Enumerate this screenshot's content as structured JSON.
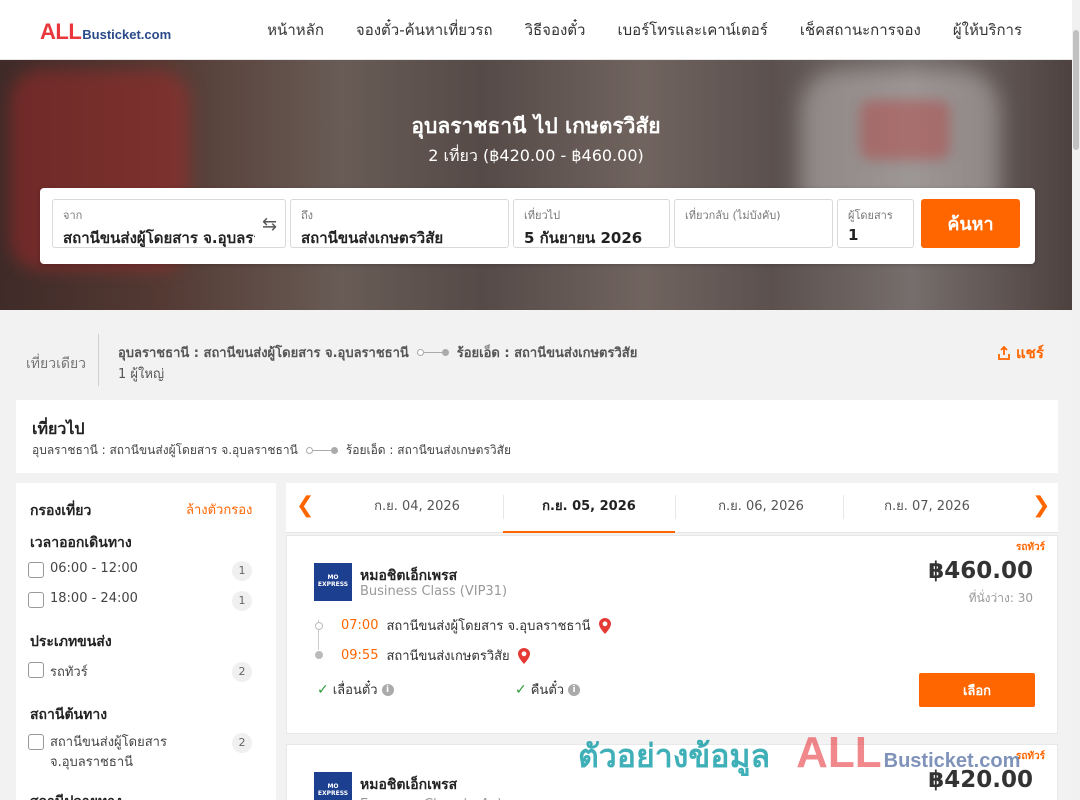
{
  "header": {
    "logo_main": "ALL",
    "logo_sub": "Busticket.com",
    "nav": [
      "หน้าหลัก",
      "จองตั๋ว-ค้นหาเที่ยวรถ",
      "วิธีจองตั๋ว",
      "เบอร์โทรและเคาน์เตอร์",
      "เช็คสถานะการจอง",
      "ผู้ให้บริการ"
    ]
  },
  "hero": {
    "title": "อุบลราชธานี ไป เกษตรวิสัย",
    "subtitle": "2 เที่ยว (฿420.00 - ฿460.00)"
  },
  "search": {
    "from_label": "จาก",
    "from_value": "สถานีขนส่งผู้โดยสาร จ.อุบลราชธานี",
    "to_label": "ถึง",
    "to_value": "สถานีขนส่งเกษตรวิสัย",
    "depart_label": "เที่ยวไป",
    "depart_value": "5 กันยายน 2026",
    "return_label": "เที่ยวกลับ (ไม่บังคับ)",
    "return_value": "",
    "pax_label": "ผู้โดยสาร",
    "pax_value": "1",
    "button": "ค้นหา"
  },
  "summary": {
    "trip_type": "เที่ยวเดียว",
    "origin": "อุบลราชธานี : สถานีขนส่งผู้โดยสาร จ.อุบลราชธานี",
    "destination": "ร้อยเอ็ด : สถานีขนส่งเกษตรวิสัย",
    "passengers": "1 ผู้ใหญ่",
    "share": "แชร์"
  },
  "departure": {
    "title": "เที่ยวไป",
    "origin": "อุบลราชธานี : สถานีขนส่งผู้โดยสาร จ.อุบลราชธานี",
    "destination": "ร้อยเอ็ด : สถานีขนส่งเกษตรวิสัย"
  },
  "filters": {
    "title": "กรองเที่ยว",
    "clear": "ล้างตัวกรอง",
    "groups": [
      {
        "label": "เวลาออกเดินทาง",
        "options": [
          {
            "label": "06:00 - 12:00",
            "count": "1"
          },
          {
            "label": "18:00 - 24:00",
            "count": "1"
          }
        ]
      },
      {
        "label": "ประเภทขนส่ง",
        "options": [
          {
            "label": "รถทัวร์",
            "count": "2"
          }
        ]
      },
      {
        "label": "สถานีต้นทาง",
        "options": [
          {
            "label": "สถานีขนส่งผู้โดยสาร จ.อุบลราชธานี",
            "line1": "สถานีขนส่งผู้โดยสาร",
            "line2": "จ.อุบลราชธานี",
            "count": "2"
          }
        ]
      },
      {
        "label": "สถานีปลายทาง",
        "options": []
      }
    ]
  },
  "date_tabs": {
    "tabs": [
      "ก.ย. 04, 2026",
      "ก.ย. 05, 2026",
      "ก.ย. 06, 2026",
      "ก.ย. 07, 2026"
    ],
    "active_index": 1
  },
  "trips": [
    {
      "type": "รถทัวร์",
      "operator": "หมอชิตเอ็กเพรส",
      "logo_text": "MO EXPRESS",
      "class": "Business Class (VIP31)",
      "price": "฿460.00",
      "seats": "ที่นั่งว่าง: 30",
      "depart_time": "07:00",
      "depart_station": "สถานีขนส่งผู้โดยสาร จ.อุบลราชธานี",
      "arrive_time": "09:55",
      "arrive_station": "สถานีขนส่งเกษตรวิสัย",
      "feature1": "เลื่อนตั๋ว",
      "feature2": "คืนตั๋ว",
      "select": "เลือก"
    },
    {
      "type": "รถทัวร์",
      "operator": "หมอชิตเอ็กเพรส",
      "logo_text": "MO EXPRESS",
      "class": "Economy Class (ม.4ข)",
      "price": "฿420.00"
    }
  ],
  "watermark": {
    "text": "ตัวอย่างข้อมูล",
    "logo_main": "ALL",
    "logo_sub": "Busticket.com"
  },
  "colors": {
    "accent": "#ff6600",
    "brand_red": "#e8383d",
    "brand_blue": "#2a4a8a"
  }
}
